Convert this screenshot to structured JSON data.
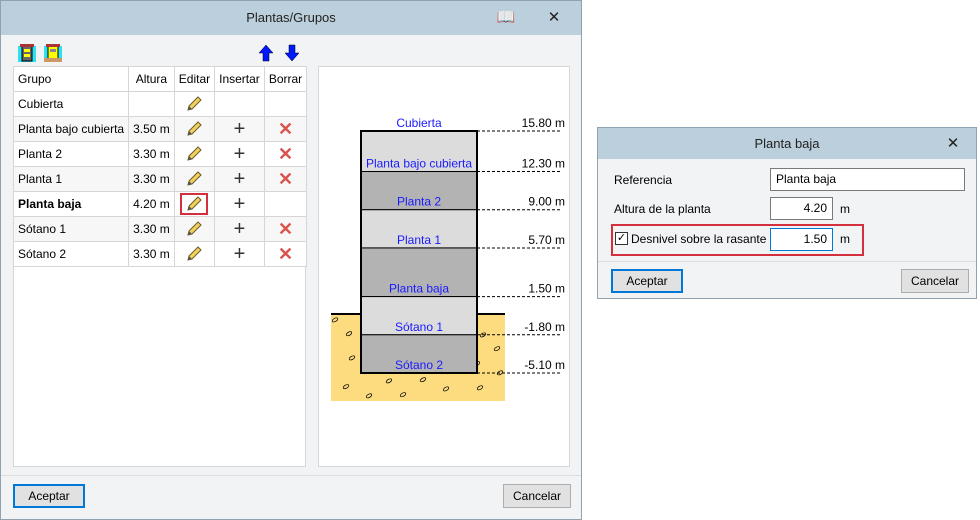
{
  "main": {
    "title": "Plantas/Grupos",
    "book_icon": "book-icon",
    "close_icon": "close-icon",
    "columns": [
      "Grupo",
      "Altura",
      "Editar",
      "Insertar",
      "Borrar"
    ],
    "rows": [
      {
        "grupo": "Cubierta",
        "altura": "",
        "insert": false,
        "delete": false,
        "bold": false
      },
      {
        "grupo": "Planta bajo cubierta",
        "altura": "3.50 m",
        "insert": true,
        "delete": true,
        "bold": false
      },
      {
        "grupo": "Planta 2",
        "altura": "3.30 m",
        "insert": true,
        "delete": true,
        "bold": false
      },
      {
        "grupo": "Planta 1",
        "altura": "3.30 m",
        "insert": true,
        "delete": true,
        "bold": false
      },
      {
        "grupo": "Planta baja",
        "altura": "4.20 m",
        "insert": true,
        "delete": false,
        "bold": true,
        "highlight": true
      },
      {
        "grupo": "Sótano 1",
        "altura": "3.30 m",
        "insert": true,
        "delete": true,
        "bold": false
      },
      {
        "grupo": "Sótano 2",
        "altura": "3.30 m",
        "insert": true,
        "delete": true,
        "bold": false
      }
    ],
    "diagram": {
      "levels": [
        {
          "name": "Cubierta",
          "elev": "15.80 m"
        },
        {
          "name": "Planta bajo cubierta",
          "elev": "12.30 m"
        },
        {
          "name": "Planta 2",
          "elev": "9.00 m"
        },
        {
          "name": "Planta 1",
          "elev": "5.70 m"
        },
        {
          "name": "Planta baja",
          "elev": "1.50 m"
        },
        {
          "name": "Sótano 1",
          "elev": "-1.80 m"
        },
        {
          "name": "Sótano 2",
          "elev": "-5.10 m"
        }
      ]
    },
    "accept": "Aceptar",
    "cancel": "Cancelar"
  },
  "dialog": {
    "title": "Planta baja",
    "referencia_label": "Referencia",
    "referencia_value": "Planta baja",
    "altura_label": "Altura de la planta",
    "altura_value": "4.20",
    "unit": "m",
    "desnivel_label": "Desnivel sobre la rasante",
    "desnivel_value": "1.50",
    "desnivel_checked": true,
    "accept": "Aceptar",
    "cancel": "Cancelar"
  },
  "colors": {
    "highlight": "#d32f3f",
    "label_blue": "#1a1aff",
    "soil": "#fddc80",
    "accent": "#0078d7"
  }
}
